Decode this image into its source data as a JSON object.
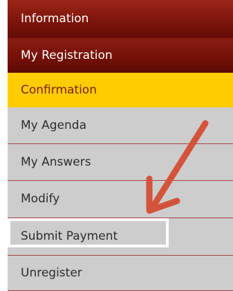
{
  "menu": {
    "items": [
      {
        "label": "Information"
      },
      {
        "label": "My Registration"
      },
      {
        "label": "Confirmation"
      },
      {
        "label": "My Agenda"
      },
      {
        "label": "My Answers"
      },
      {
        "label": "Modify"
      },
      {
        "label": "Submit Payment"
      },
      {
        "label": "Unregister"
      }
    ]
  },
  "colors": {
    "dark_item": "#741108",
    "active_item": "#ffcc00",
    "active_text": "#7a1d0b",
    "grey_item": "#cdcdcd",
    "divider": "#a8413a",
    "arrow": "#d4533b",
    "highlight_border": "#ffffff"
  },
  "annotation": {
    "arrow_icon": "arrow-pointing-down-left",
    "highlighted_item": "Submit Payment"
  }
}
